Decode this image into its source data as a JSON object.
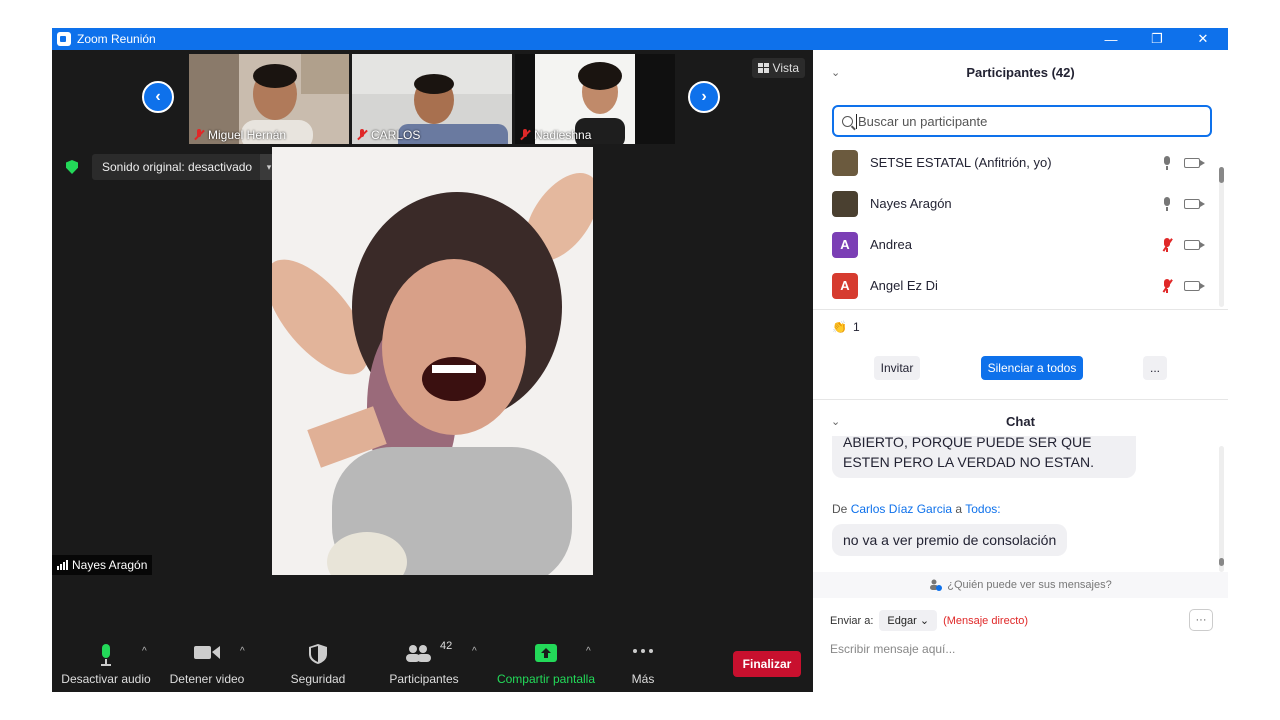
{
  "window": {
    "title": "Zoom Reunión",
    "minimize": "—",
    "restore": "❐",
    "close": "✕"
  },
  "thumbnails": [
    {
      "name": "Miguel Hernán",
      "muted": true
    },
    {
      "name": "CARLOS",
      "muted": true
    },
    {
      "name": "Nadieshna",
      "muted": true
    }
  ],
  "nav": {
    "prev": "‹",
    "next": "›"
  },
  "view_button": "Vista",
  "sound": {
    "label": "Sonido original: desactivado",
    "dropdown": "▾"
  },
  "active_speaker": "Nayes Aragón",
  "toolbar": {
    "mute": "Desactivar audio",
    "video": "Detener video",
    "security": "Seguridad",
    "participants": "Participantes",
    "participants_count": "42",
    "share": "Compartir pantalla",
    "more": "Más",
    "end": "Finalizar",
    "caret": "^"
  },
  "participants_panel": {
    "title": "Participantes (42)",
    "collapse": "⌄",
    "search_placeholder": "Buscar un participante",
    "list": [
      {
        "name": "SETSE ESTATAL (Anfitrión, yo)",
        "avatar": "",
        "avatar_color": "#6b5a3e",
        "muted": false
      },
      {
        "name": "Nayes Aragón",
        "avatar": "",
        "avatar_color": "#4a4030",
        "muted": false
      },
      {
        "name": "Andrea",
        "avatar": "A",
        "avatar_color": "#7b3fb5",
        "muted": true
      },
      {
        "name": "Angel Ez Di",
        "avatar": "A",
        "avatar_color": "#d63b2f",
        "muted": true
      }
    ],
    "reaction_emoji": "👏",
    "reaction_count": "1",
    "invite": "Invitar",
    "mute_all": "Silenciar a todos",
    "more": "..."
  },
  "chat": {
    "title": "Chat",
    "collapse": "⌄",
    "message1": "ABIERTO, PORQUE PUEDE SER QUE ESTEN PERO LA VERDAD NO ESTAN.",
    "from_prefix": "De",
    "from_name": "Carlos Díaz Garcia",
    "from_mid": "a",
    "from_to": "Todos:",
    "message2": "no va a ver premio de consolación",
    "who_sees": "¿Quién puede ver sus mensajes?",
    "send_to_label": "Enviar a:",
    "send_to_value": "Edgar",
    "send_to_caret": "⌄",
    "direct": "(Mensaje directo)",
    "more": "···",
    "compose_placeholder": "Escribir mensaje aquí..."
  },
  "colors": {
    "accent": "#0e71eb",
    "end": "#c8102e",
    "share": "#23d959",
    "muted": "#e02828"
  }
}
